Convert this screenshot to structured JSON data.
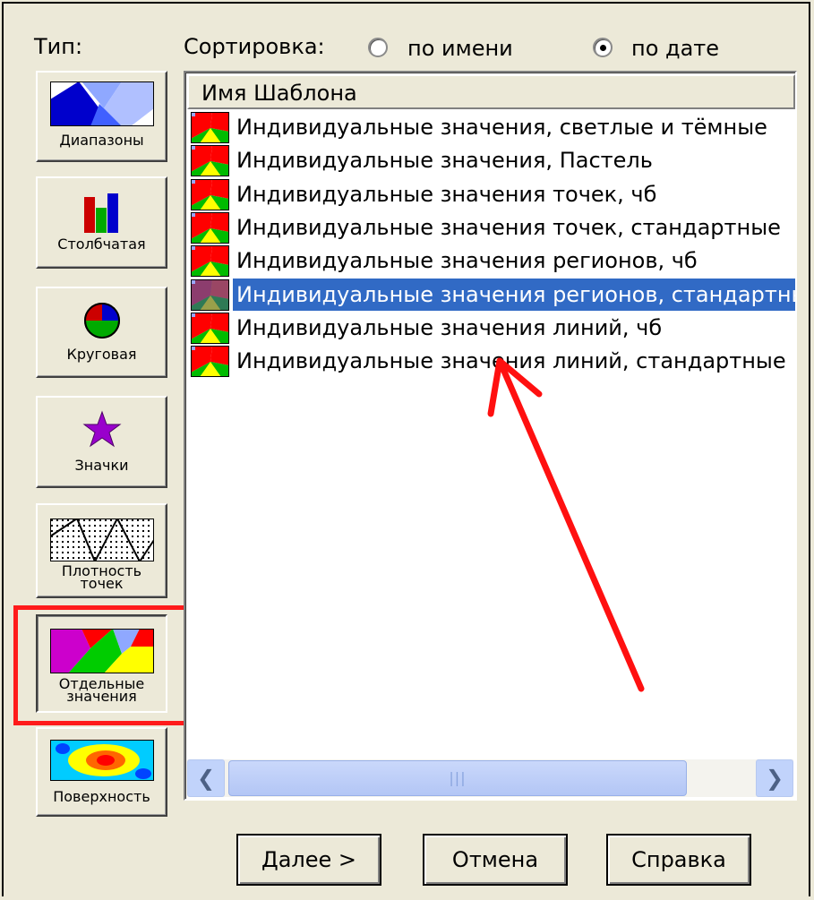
{
  "type_label": "Тип:",
  "sort": {
    "label": "Сортировка:",
    "by_name": "по имени",
    "by_date": "по дате",
    "selected": "by_date"
  },
  "types": [
    {
      "label": "Диапазоны",
      "icon": "ranges-icon"
    },
    {
      "label": "Столбчатая",
      "icon": "bar-chart-icon"
    },
    {
      "label": "Круговая",
      "icon": "pie-chart-icon"
    },
    {
      "label": "Значки",
      "icon": "star-icon"
    },
    {
      "label_line1": "Плотность",
      "label_line2": "точек",
      "icon": "dot-density-icon"
    },
    {
      "label_line1": "Отдельные",
      "label_line2": "значения",
      "icon": "individual-values-icon",
      "highlighted": true
    },
    {
      "label": "Поверхность",
      "icon": "surface-icon"
    }
  ],
  "list": {
    "header": "Имя Шаблона",
    "items": [
      "Индивидуальные значения, светлые и тёмные",
      "Индивидуальные значения, Пастель",
      "Индивидуальные значения точек, чб",
      "Индивидуальные значения точек, стандартные",
      "Индивидуальные значения регионов, чб",
      "Индивидуальные значения регионов, стандартные",
      "Индивидуальные значения линий, чб",
      "Индивидуальные значения линий, стандартные"
    ],
    "selected_index": 5
  },
  "buttons": {
    "next": "Далее >",
    "cancel": "Отмена",
    "help": "Справка"
  },
  "colors": {
    "selection": "#316ac5",
    "highlight_box": "#ff1b1b",
    "annotation_arrow": "#ff1010"
  }
}
